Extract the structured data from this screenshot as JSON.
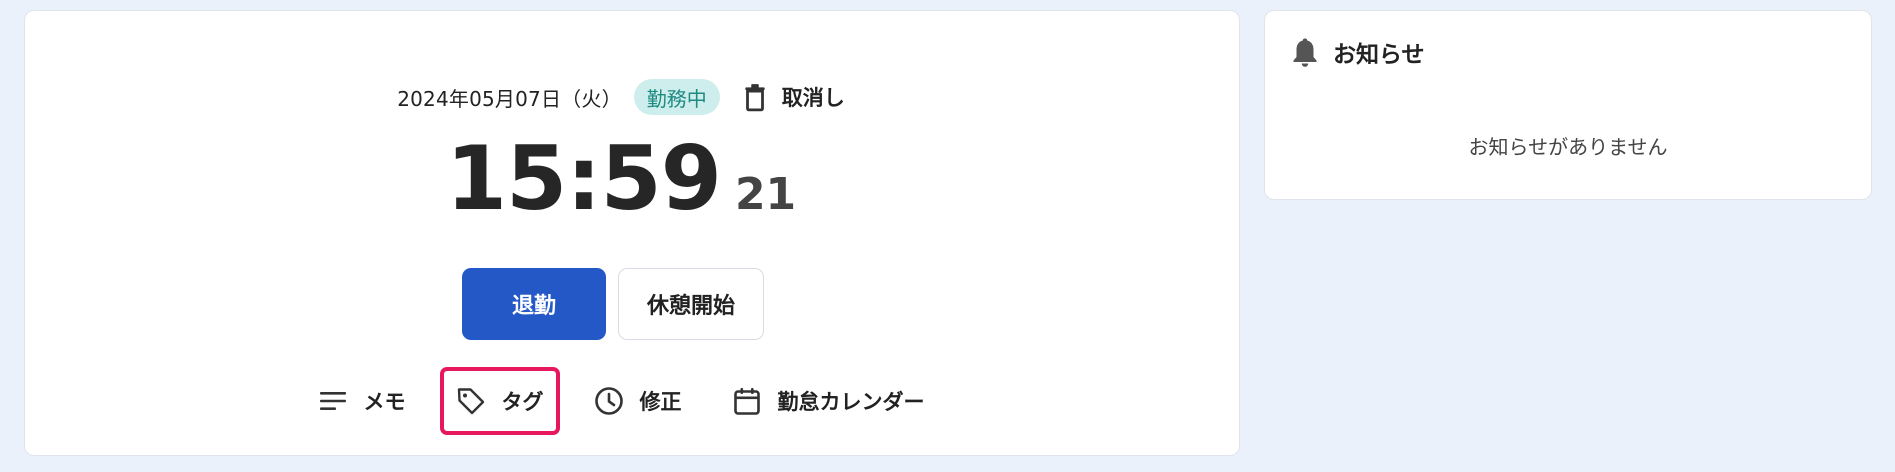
{
  "attendance": {
    "date": "2024年05月07日（火）",
    "status": "勤務中",
    "cancel_label": "取消し",
    "time_main": "15:59",
    "time_seconds": "21",
    "clock_out_label": "退勤",
    "break_start_label": "休憩開始",
    "tools": {
      "memo": "メモ",
      "tag": "タグ",
      "edit": "修正",
      "calendar": "勤怠カレンダー"
    }
  },
  "notice": {
    "title": "お知らせ",
    "empty_message": "お知らせがありません"
  },
  "colors": {
    "background": "#ebf1fb",
    "primary": "#2558c7",
    "status_badge_bg": "#cdeeec",
    "status_badge_text": "#1f8a82",
    "highlight": "#e5175e"
  },
  "icons": {
    "cancel": "trash-icon",
    "memo": "lines-icon",
    "tag": "tag-icon",
    "edit": "clock-icon",
    "calendar": "calendar-icon",
    "notice": "bell-icon"
  }
}
